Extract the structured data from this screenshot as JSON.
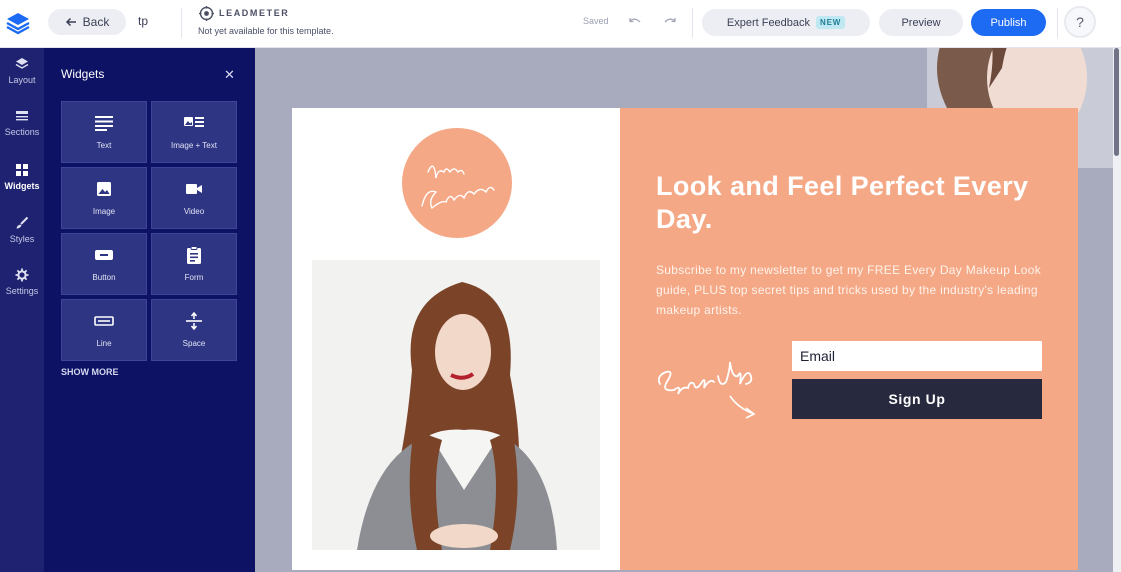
{
  "topbar": {
    "back_label": "Back",
    "page_name": "tp",
    "brand_name": "LEADMETER",
    "brand_subtitle": "Not yet available for this template.",
    "saved_status": "Saved",
    "expert_feedback_label": "Expert Feedback",
    "new_badge": "NEW",
    "preview_label": "Preview",
    "publish_label": "Publish",
    "help_label": "?"
  },
  "rail": {
    "items": [
      {
        "label": "Layout",
        "icon": "layers-icon"
      },
      {
        "label": "Sections",
        "icon": "sections-icon"
      },
      {
        "label": "Widgets",
        "icon": "widgets-icon",
        "active": true
      },
      {
        "label": "Styles",
        "icon": "brush-icon"
      },
      {
        "label": "Settings",
        "icon": "gear-icon"
      }
    ]
  },
  "widgets_panel": {
    "title": "Widgets",
    "close": "✕",
    "tiles": [
      {
        "label": "Text",
        "icon": "text-icon"
      },
      {
        "label": "Image + Text",
        "icon": "image-text-icon"
      },
      {
        "label": "Image",
        "icon": "image-icon"
      },
      {
        "label": "Video",
        "icon": "video-icon"
      },
      {
        "label": "Button",
        "icon": "button-icon"
      },
      {
        "label": "Form",
        "icon": "form-icon"
      },
      {
        "label": "Line",
        "icon": "line-icon"
      },
      {
        "label": "Space",
        "icon": "space-icon"
      }
    ],
    "show_more": "SHOW MORE"
  },
  "landing_page": {
    "signature": "Laura Claudette",
    "headline": "Look and Feel Perfect Every Day.",
    "subtext": "Subscribe to my newsletter to get my FREE Every Day Makeup Look guide, PLUS top secret tips and tricks used by the industry's leading makeup artists.",
    "script_cta": "Sign Up",
    "email_placeholder": "Email",
    "signup_button": "Sign Up"
  },
  "colors": {
    "accent_blue": "#1d6af3",
    "panel_navy": "#0d1264",
    "rail_navy": "#1e2270",
    "peach": "#f4a886",
    "button_dark": "#272a3e"
  }
}
